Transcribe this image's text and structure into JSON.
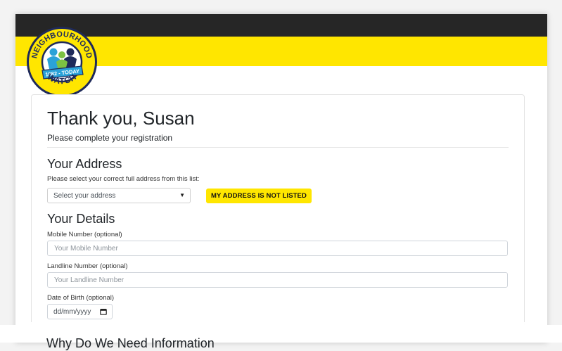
{
  "logo": {
    "top_text": "NEIGHBOURHOOD",
    "bottom_text": "WATCH",
    "ribbon_text": "1982 - TODAY",
    "colors": {
      "yellow": "#ffe600",
      "navy": "#1f2a5a",
      "blue": "#2aa2d8",
      "green": "#7cc242"
    }
  },
  "header": {
    "dark_color": "#262626",
    "yellow_color": "#ffe600"
  },
  "greeting": {
    "title": "Thank you, Susan",
    "subtitle": "Please complete your registration"
  },
  "address": {
    "heading": "Your Address",
    "help": "Please select your correct full address from this list:",
    "select_value": "Select your address",
    "not_listed_label": "MY ADDRESS IS NOT LISTED"
  },
  "details": {
    "heading": "Your Details",
    "mobile_label": "Mobile Number (optional)",
    "mobile_placeholder": "Your Mobile Number",
    "landline_label": "Landline Number (optional)",
    "landline_placeholder": "Your Landline Number",
    "dob_label": "Date of Birth (optional)",
    "dob_placeholder": "dd/mm/yyyy"
  },
  "next_section": {
    "heading": "Why Do We Need Information"
  }
}
